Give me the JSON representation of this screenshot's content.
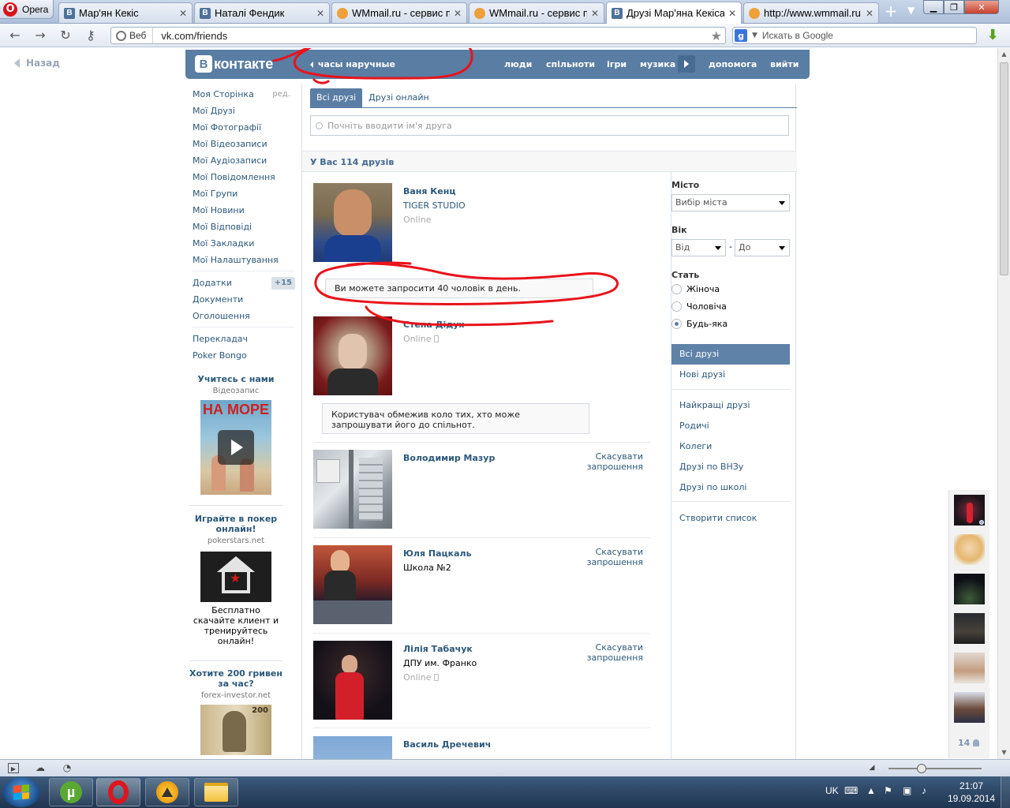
{
  "browser": {
    "menu_label": "Opera",
    "tabs": [
      {
        "title": "Мар'ян Кекіс",
        "favicon": "vk-icon"
      },
      {
        "title": "Наталі Фендик",
        "favicon": "vk-icon"
      },
      {
        "title": "WMmail.ru - сервис п...",
        "favicon": "wmmail-icon"
      },
      {
        "title": "WMmail.ru - сервис п...",
        "favicon": "wmmail-icon"
      },
      {
        "title": "Друзі Мар'яна Кекіса |...",
        "favicon": "vk-icon"
      },
      {
        "title": "http://www.wmmail.ru...",
        "favicon": "wmmail-icon"
      }
    ],
    "active_tab": 4,
    "address_mode": "Веб",
    "url": "vk.com/friends",
    "search_placeholder": "Искать в Google",
    "status_bar_icons": [
      "panel-toggle-icon",
      "cloud-icon",
      "speed-dial-icon"
    ]
  },
  "vk": {
    "back_label": "Назад",
    "logo_text": "контакте",
    "logo_letter": "В",
    "status_text": "часы наручные",
    "topnav": [
      "люди",
      "спільноти",
      "ігри",
      "музика",
      "допомога",
      "вийти"
    ],
    "left_menu": {
      "main": [
        "Моя Сторінка",
        "Мої Друзі",
        "Мої Фотографії",
        "Мої Відеозаписи",
        "Мої Аудіозаписи",
        "Мої Повідомлення",
        "Мої Групи",
        "Мої Новини",
        "Мої Відповіді",
        "Мої Закладки",
        "Мої Налаштування"
      ],
      "edit_label": "ред.",
      "apps_label": "Додатки",
      "apps_badge": "+15",
      "secondary": [
        "Документи",
        "Оголошення"
      ],
      "extra": [
        "Перекладач",
        "Poker Bongo"
      ]
    },
    "ads": [
      {
        "title": "Учитесь с нами",
        "domain": "Відеозапис",
        "image_caption": "НА МОРЕ"
      },
      {
        "title": "Играйте в покер онлайн!",
        "domain": "pokerstars.net",
        "text": "Бесплатно скачайте клиент и тренируйтесь онлайн!"
      },
      {
        "title": "Хотите 200 гривен за час?",
        "domain": "forex-investor.net",
        "image_caption": "200"
      }
    ],
    "tabs": [
      "Всі друзі",
      "Друзі онлайн"
    ],
    "search_placeholder": "Почніть вводити ім'я друга",
    "friends_count_label": "У Вас 114 друзів",
    "invite_notice": "Ви можете запросити 40 чоловік в день.",
    "restricted_notice": "Користувач обмежив коло тих, хто може запрошувати його до спільнот.",
    "friends": [
      {
        "name": "Ваня Кенц",
        "line2": "TIGER STUDIO",
        "status": "Online",
        "action": ""
      },
      {
        "name": "Степа Дідух",
        "line2": "",
        "status": "Online",
        "action": ""
      },
      {
        "name": "Володимир Мазур",
        "line2": "",
        "status": "",
        "action": "Скасувати запрошення"
      },
      {
        "name": "Юля Пацкаль",
        "line2": "Школа №2",
        "status": "",
        "action": "Скасувати запрошення"
      },
      {
        "name": "Лілія Табачук",
        "line2": "ДПУ им. Франко",
        "status": "Online",
        "action": "Скасувати запрошення"
      },
      {
        "name": "Василь Дречевич",
        "line2": "",
        "status": "",
        "action": ""
      }
    ],
    "filters": {
      "city_label": "Місто",
      "city_value": "Вибір міста",
      "age_label": "Вік",
      "age_from": "Від",
      "age_dash": "-",
      "age_to": "До",
      "sex_label": "Стать",
      "sex_options": [
        "Жіноча",
        "Чоловіча",
        "Будь-яка"
      ],
      "sex_selected": 2,
      "lists": [
        "Всі друзі",
        "Нові друзі"
      ],
      "lists2": [
        "Найкращі друзі",
        "Родичі",
        "Колеги",
        "Друзі по ВНЗу",
        "Друзі по школі"
      ],
      "create_list": "Створити список"
    },
    "chat_count": "14"
  },
  "taskbar": {
    "apps": [
      "windows-start",
      "utorrent-icon",
      "opera-icon",
      "aimp-icon",
      "explorer-icon"
    ],
    "lang": "UK",
    "time": "21:07",
    "date": "19.09.2014"
  },
  "colors": {
    "vk_header": "#597da3",
    "vk_link": "#2b587a",
    "annotation_red": "#e8131b"
  }
}
